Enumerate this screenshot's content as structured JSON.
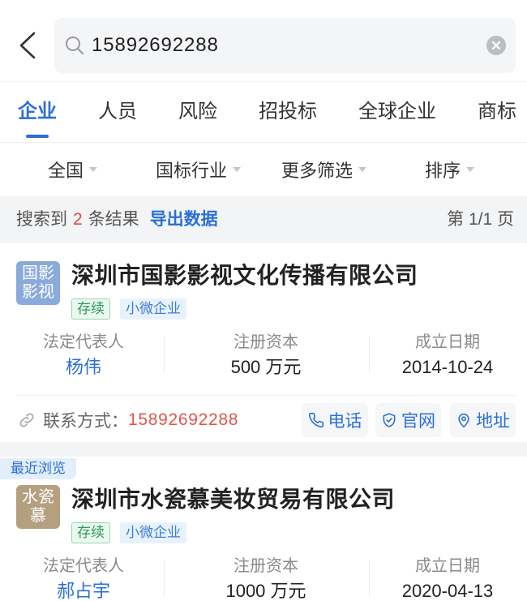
{
  "colors": {
    "primary": "#2b6fd6",
    "count_red": "#e8453c",
    "phone_red": "#e0574b",
    "status_green": "#2c9a5a",
    "page_bg": "#f3f4f6"
  },
  "header": {
    "back_icon": "chevron-left-icon",
    "search_icon": "search-icon",
    "clear_icon": "clear-circle-icon",
    "query": "15892692288"
  },
  "tabs": [
    {
      "label": "企业",
      "active": true
    },
    {
      "label": "人员",
      "active": false
    },
    {
      "label": "风险",
      "active": false
    },
    {
      "label": "招投标",
      "active": false
    },
    {
      "label": "全球企业",
      "active": false
    },
    {
      "label": "商标",
      "active": false
    }
  ],
  "filters": [
    {
      "label": "全国",
      "icon": "caret-down-icon"
    },
    {
      "label": "国标行业",
      "icon": "caret-down-icon"
    },
    {
      "label": "更多筛选",
      "icon": "caret-down-icon"
    },
    {
      "label": "排序",
      "icon": "caret-down-icon"
    }
  ],
  "summary": {
    "prefix": "搜索到",
    "count": "2",
    "suffix": "条结果",
    "export_label": "导出数据",
    "page_label": "第 1/1 页"
  },
  "results": [
    {
      "logo": {
        "line1": "国影",
        "line2": "影视",
        "color": "#8aaadc"
      },
      "name": "深圳市国影影视文化传播有限公司",
      "status_tag": "存续",
      "size_tag": "小微企业",
      "fields": [
        {
          "label": "法定代表人",
          "value": "杨伟"
        },
        {
          "label": "注册资本",
          "value": "500 万元"
        },
        {
          "label": "成立日期",
          "value": "2014-10-24"
        }
      ],
      "contact": {
        "icon": "link-icon",
        "label": "联系方式：",
        "phone": "15892692288"
      },
      "actions": [
        {
          "label": "电话",
          "icon": "phone-icon"
        },
        {
          "label": "官网",
          "icon": "shield-check-icon"
        },
        {
          "label": "地址",
          "icon": "location-pin-icon"
        }
      ]
    },
    {
      "badge": "最近浏览",
      "logo": {
        "line1": "水瓷",
        "line2": "慕",
        "color": "#b49f7e"
      },
      "name": "深圳市水瓷慕美妆贸易有限公司",
      "status_tag": "存续",
      "size_tag": "小微企业",
      "fields": [
        {
          "label": "法定代表人",
          "value": "郝占宇"
        },
        {
          "label": "注册资本",
          "value": "1000 万元"
        },
        {
          "label": "成立日期",
          "value": "2020-04-13"
        }
      ]
    }
  ]
}
